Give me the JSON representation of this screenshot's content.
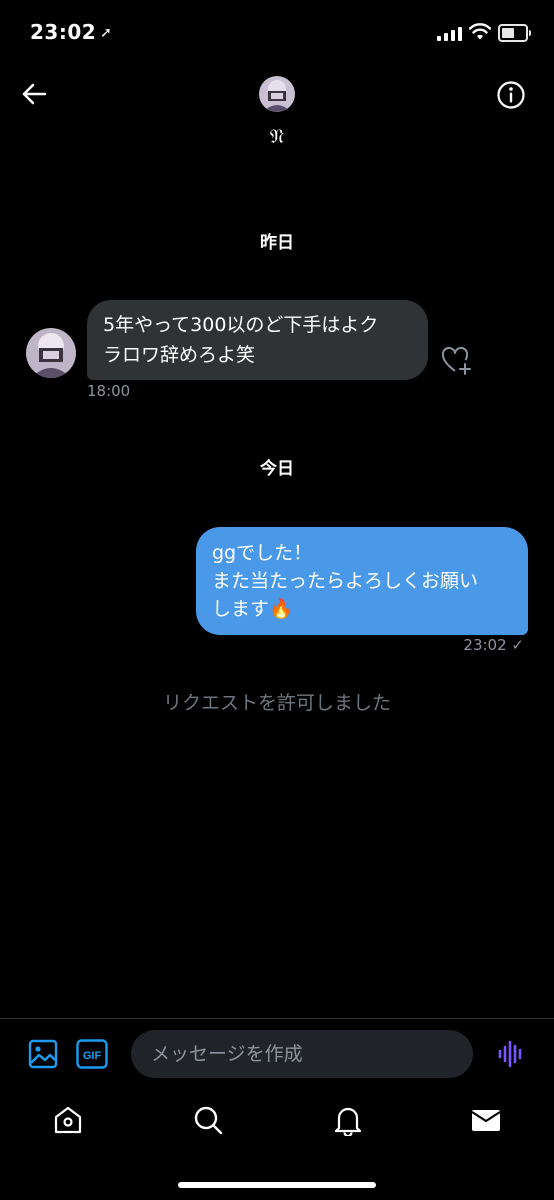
{
  "status_bar": {
    "time": "23:02",
    "location_icon": "location-arrow-icon"
  },
  "header": {
    "contact_name": "𝔑",
    "back_icon": "back-arrow-icon",
    "info_icon": "info-icon"
  },
  "conversation": {
    "date_yesterday": "昨日",
    "received_message": {
      "text_line1": "5年やって300以のど下手はよク",
      "text_line2": "ラロワ辞めろよ笑",
      "time": "18:00"
    },
    "date_today": "今日",
    "sent_message": {
      "text_line1": "ggでした！",
      "text_line2": "また当たったらよろしくお願い",
      "text_line3": "します🔥",
      "time": "23:02",
      "read_mark": "✓"
    },
    "system_message": "リクエストを許可しました"
  },
  "composer": {
    "placeholder": "メッセージを作成",
    "value": "",
    "gif_label": "GIF"
  },
  "colors": {
    "background": "#000000",
    "bubble_in": "#2f3336",
    "bubble_out": "#4a99e9",
    "accent": "#1d9bf0",
    "voice": "#7856ff"
  },
  "tab_bar": {
    "items": [
      {
        "icon": "home-icon"
      },
      {
        "icon": "search-icon"
      },
      {
        "icon": "notifications-icon"
      },
      {
        "icon": "messages-icon"
      }
    ]
  }
}
